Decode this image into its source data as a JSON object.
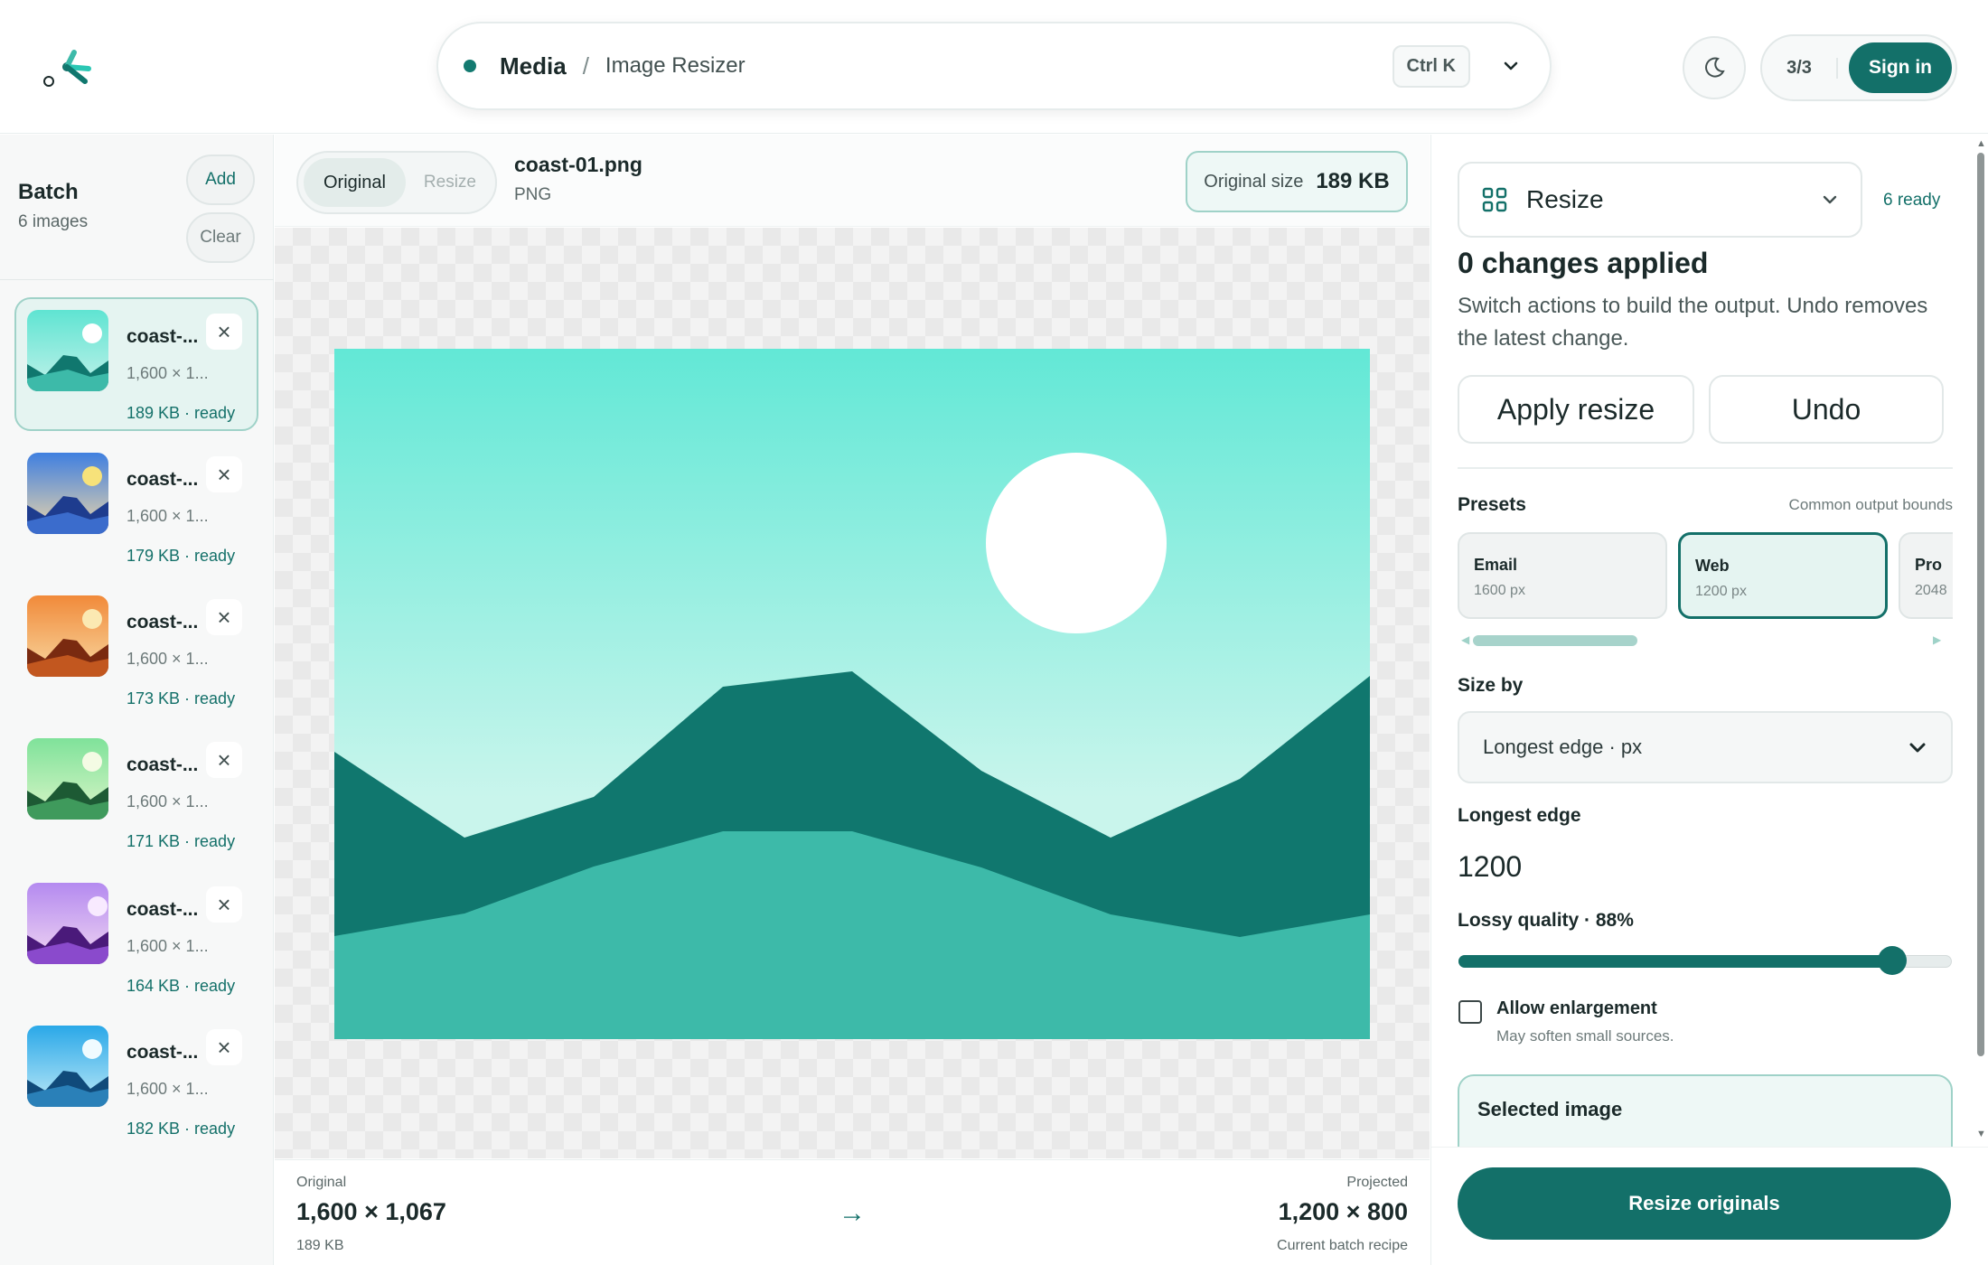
{
  "header": {
    "section": "Media",
    "separator": "/",
    "page": "Image Resizer",
    "shortcut": "Ctrl K",
    "session_count": "3/3",
    "sign_in_label": "Sign in"
  },
  "sidebar": {
    "title": "Batch",
    "count": "6 images",
    "add_label": "Add",
    "clear_label": "Clear",
    "items": [
      {
        "name": "coast-...",
        "dims": "1,600 × 1...",
        "meta": "189 KB · ready",
        "remove": "×"
      },
      {
        "name": "coast-...",
        "dims": "1,600 × 1...",
        "meta": "179 KB · ready",
        "remove": "×"
      },
      {
        "name": "coast-...",
        "dims": "1,600 × 1...",
        "meta": "173 KB · ready",
        "remove": "×"
      },
      {
        "name": "coast-...",
        "dims": "1,600 × 1...",
        "meta": "171 KB · ready",
        "remove": "×"
      },
      {
        "name": "coast-...",
        "dims": "1,600 × 1...",
        "meta": "164 KB · ready",
        "remove": "×"
      },
      {
        "name": "coast-...",
        "dims": "1,600 × 1...",
        "meta": "182 KB · ready",
        "remove": "×"
      }
    ]
  },
  "viewer": {
    "tabs": {
      "original": "Original",
      "resize": "Resize"
    },
    "file_name": "coast-01.png",
    "file_type": "PNG",
    "size_label": "Original size",
    "size_value": "189 KB"
  },
  "footer_stats": {
    "original_label": "Original",
    "original_dims": "1,600 × 1,067",
    "original_size": "189 KB",
    "arrow": "→",
    "projected_label": "Projected",
    "projected_dims": "1,200 × 800",
    "projected_note": "Current batch recipe"
  },
  "panel": {
    "action": "Resize",
    "ready": "6 ready",
    "changes_title": "0 changes applied",
    "changes_desc": "Switch actions to build the output. Undo removes the latest change.",
    "apply_label": "Apply resize",
    "undo_label": "Undo",
    "presets_label": "Presets",
    "presets_note": "Common output bounds",
    "presets": [
      {
        "name": "Email",
        "size": "1600 px"
      },
      {
        "name": "Web",
        "size": "1200 px"
      },
      {
        "name": "Pro",
        "size": "2048"
      }
    ],
    "size_by_label": "Size by",
    "size_by_value": "Longest edge · px",
    "edge_label": "Longest edge",
    "edge_value": "1200",
    "quality_label": "Lossy quality · 88%",
    "quality_value": 88,
    "enlarge_label": "Allow enlargement",
    "enlarge_note": "May soften small sources.",
    "enlarge_checked": false,
    "selected_title": "Selected image",
    "resize_originals_label": "Resize originals"
  },
  "colors": {
    "accent": "#137069",
    "accent_light": "#e5f4f1",
    "sky_top": "#62e8d6",
    "sky_bottom": "#c9f5ec",
    "mountain_dark": "#10776e",
    "mountain_light": "#3dbaa9"
  },
  "icons": [
    "app-logo-icon",
    "chevron-down-icon",
    "moon-icon",
    "close-icon",
    "grid-icon",
    "arrow-right-icon"
  ]
}
